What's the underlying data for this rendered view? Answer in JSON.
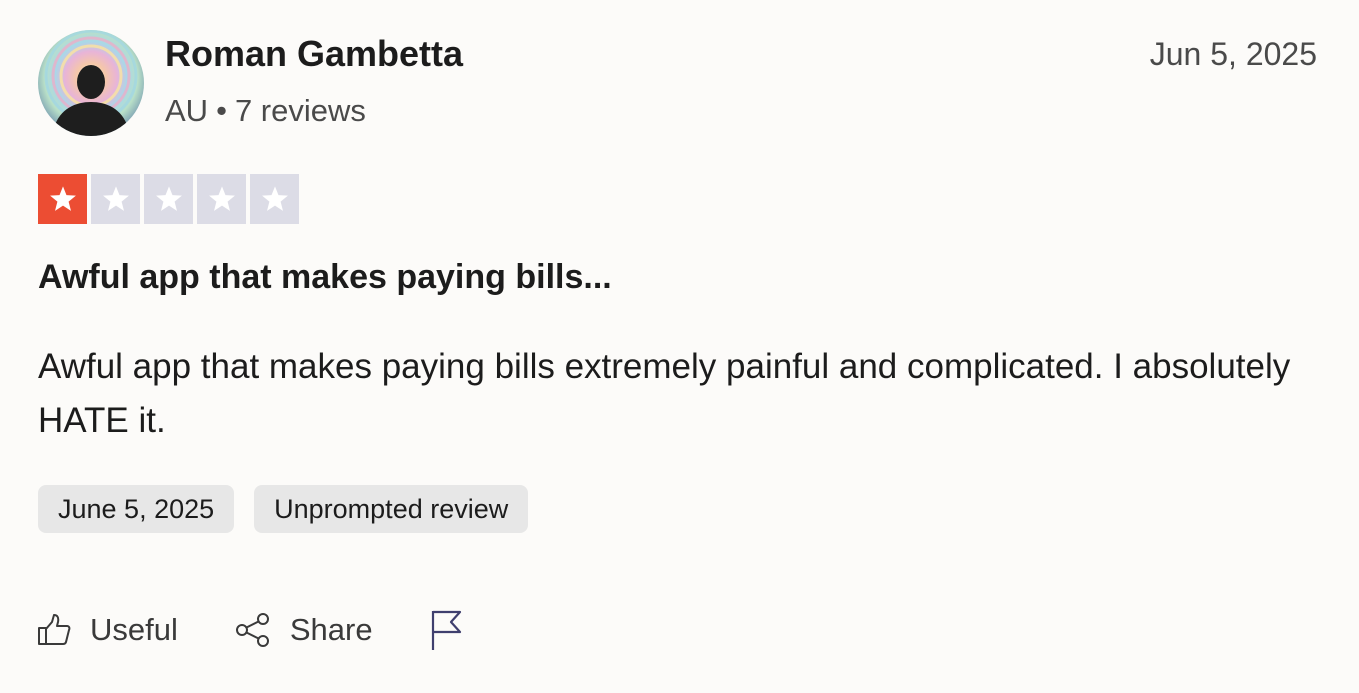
{
  "reviewer": {
    "name": "Roman Gambetta",
    "country": "AU",
    "separator": "•",
    "review_count": "7 reviews"
  },
  "review": {
    "date": "Jun 5, 2025",
    "rating": 1,
    "rating_max": 5,
    "title": "Awful app that makes paying bills...",
    "body": "Awful app that makes paying bills extremely painful and complicated. I absolutely HATE it."
  },
  "tags": {
    "experience_date": "June 5, 2025",
    "review_type": "Unprompted review"
  },
  "actions": {
    "useful_label": "Useful",
    "share_label": "Share",
    "report_icon": "flag-icon"
  },
  "colors": {
    "star_filled": "#ec4d33",
    "star_empty": "#dcdce6",
    "tag_bg": "#e7e7e7",
    "background": "#fcfbf9"
  }
}
